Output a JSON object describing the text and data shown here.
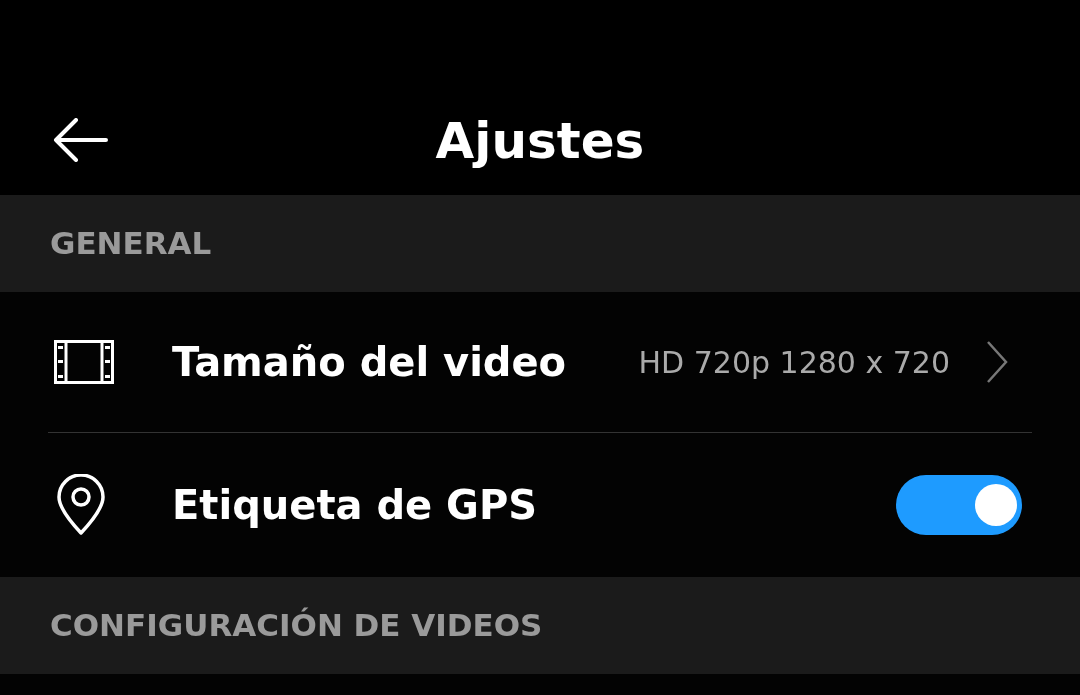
{
  "header": {
    "title": "Ajustes"
  },
  "sections": [
    {
      "title": "GENERAL",
      "items": [
        {
          "kind": "value",
          "label": "Tamaño del video",
          "value": "HD 720p 1280 x 720"
        },
        {
          "kind": "toggle",
          "label": "Etiqueta de GPS",
          "on": true
        }
      ]
    },
    {
      "title": "CONFIGURACIÓN DE VIDEOS"
    }
  ]
}
